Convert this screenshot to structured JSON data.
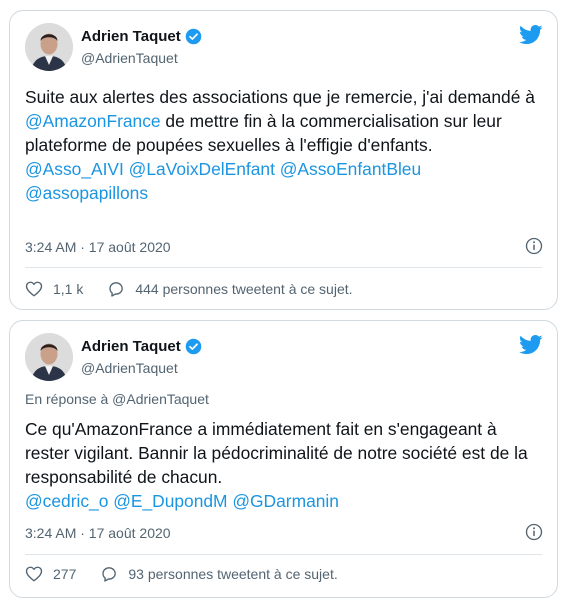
{
  "tweets": [
    {
      "author_name": "Adrien Taquet",
      "author_handle": "@AdrienTaquet",
      "text_before": "Suite aux alertes des associations que je remercie, j'ai demandé à ",
      "mention_inline": "@AmazonFrance",
      "text_after": " de mettre fin à la commercialisation sur leur plateforme de poupées sexuelles à l'effigie d'enfants.",
      "tags_line": "@Asso_AIVI @LaVoixDelEnfant @AssoEnfantBleu @assopapillons",
      "timestamp": "3:24 AM · 17 août 2020",
      "likes": "1,1 k",
      "retweet_text": "444 personnes tweetent à ce sujet."
    },
    {
      "author_name": "Adrien Taquet",
      "author_handle": "@AdrienTaquet",
      "reply_to": "En réponse à @AdrienTaquet",
      "text": "Ce qu'AmazonFrance a immédiatement fait en s'engageant à rester vigilant. Bannir la pédocriminalité de notre société est de la responsabilité de chacun.",
      "tags_line": "@cedric_o @E_DupondM @GDarmanin",
      "timestamp": "3:24 AM · 17 août 2020",
      "likes": "277",
      "retweet_text": "93 personnes tweetent à ce sujet."
    }
  ],
  "colors": {
    "accent": "#1b95e0",
    "verified": "#1d9bf0",
    "secondary_text": "#536471",
    "border": "#cfd9de"
  },
  "icons": {
    "brand": "twitter-bird-icon",
    "verified": "verified-badge-icon",
    "info": "info-icon",
    "like": "heart-icon",
    "conversation": "speech-bubble-icon"
  }
}
